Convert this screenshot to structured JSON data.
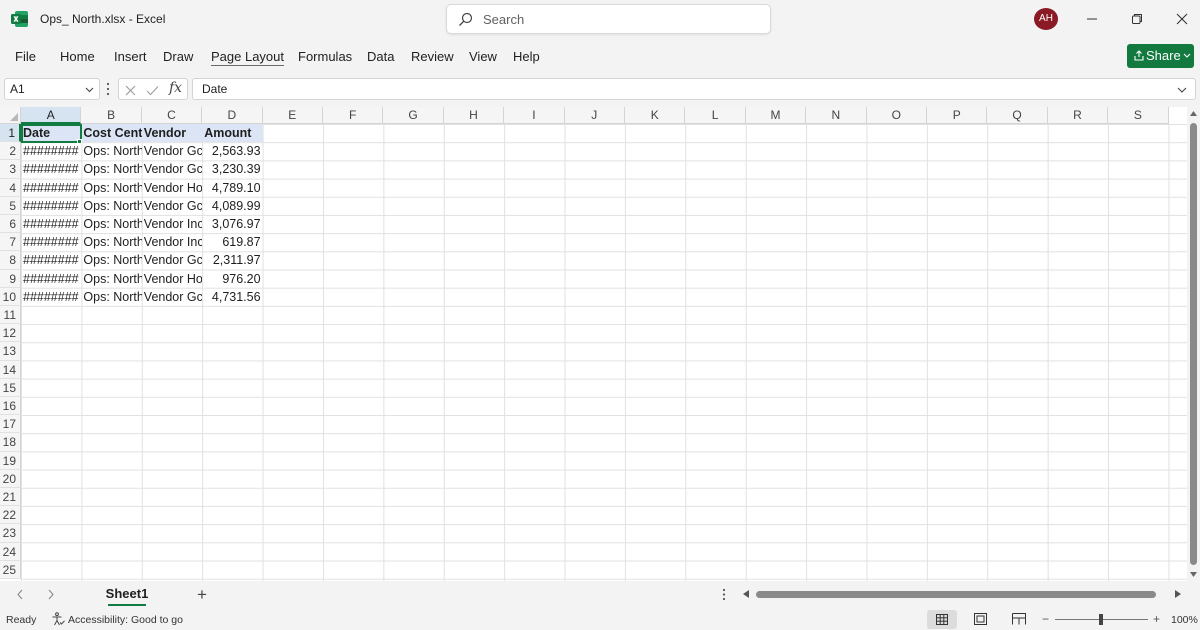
{
  "window": {
    "title": "Ops_ North.xlsx  -  Excel",
    "app_icon": "excel-icon",
    "search_placeholder": "Search",
    "avatar_initials": "AH",
    "brand_color": "#107c41",
    "avatar_color": "#8a1a24"
  },
  "ribbon": {
    "tabs": [
      "File",
      "Home",
      "Insert",
      "Draw",
      "Page Layout",
      "Formulas",
      "Data",
      "Review",
      "View",
      "Help"
    ],
    "active_tab": "Page Layout",
    "share_label": "Share"
  },
  "formula_bar": {
    "name_box": "A1",
    "content": "Date",
    "fx_label": "fx"
  },
  "grid": {
    "columns": [
      "A",
      "B",
      "C",
      "D",
      "E",
      "F",
      "G",
      "H",
      "I",
      "J",
      "K",
      "L",
      "M",
      "N",
      "O",
      "P",
      "Q",
      "R",
      "S"
    ],
    "row_numbers": [
      "1",
      "2",
      "3",
      "4",
      "5",
      "6",
      "7",
      "8",
      "9",
      "10",
      "11",
      "12",
      "13",
      "14",
      "15",
      "16",
      "17",
      "18",
      "19",
      "20",
      "21",
      "22",
      "23",
      "24",
      "25"
    ],
    "selected_cell": "A1",
    "header_row": [
      "Date",
      "Cost Cent",
      "Vendor",
      "Amount"
    ],
    "rows": [
      [
        "########",
        "Ops: North",
        "Vendor Gc",
        "2,563.93"
      ],
      [
        "########",
        "Ops: North",
        "Vendor Gc",
        "3,230.39"
      ],
      [
        "########",
        "Ops: North",
        "Vendor Ho",
        "4,789.10"
      ],
      [
        "########",
        "Ops: North",
        "Vendor Gc",
        "4,089.99"
      ],
      [
        "########",
        "Ops: North",
        "Vendor Inc",
        "3,076.97"
      ],
      [
        "########",
        "Ops: North",
        "Vendor Inc",
        "619.87"
      ],
      [
        "########",
        "Ops: North",
        "Vendor Gc",
        "2,311.97"
      ],
      [
        "########",
        "Ops: North",
        "Vendor Ho",
        "976.20"
      ],
      [
        "########",
        "Ops: North",
        "Vendor Gc",
        "4,731.56"
      ]
    ]
  },
  "sheets": {
    "tabs": [
      "Sheet1"
    ],
    "active": "Sheet1",
    "add_label": "+"
  },
  "status": {
    "ready": "Ready",
    "accessibility": "Accessibility: Good to go",
    "zoom": "100%",
    "zoom_minus": "−",
    "zoom_plus": "+"
  }
}
